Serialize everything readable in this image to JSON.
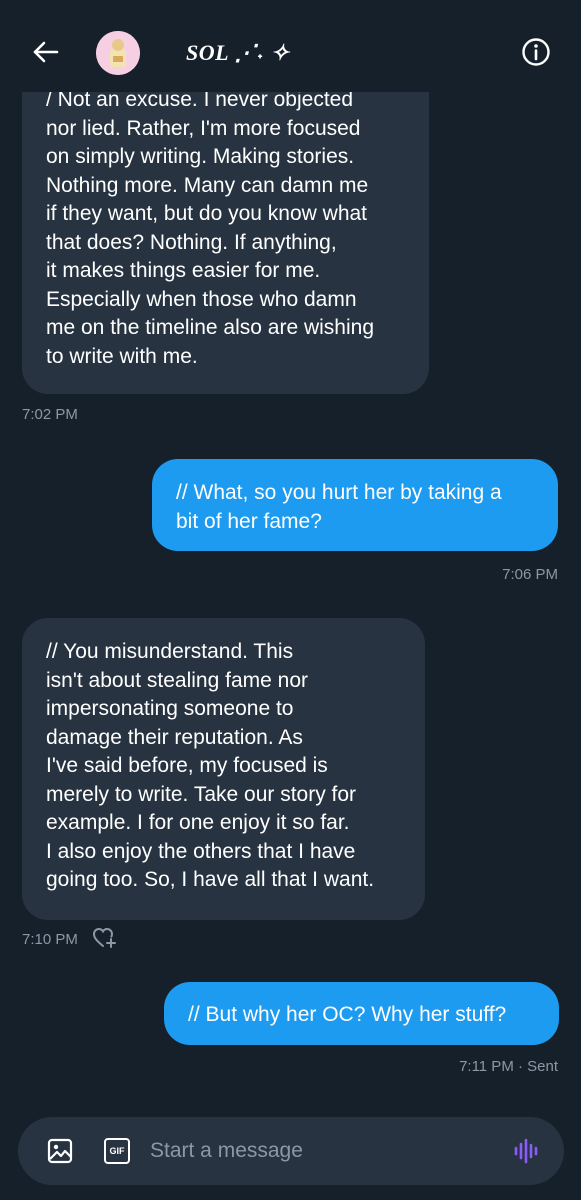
{
  "header": {
    "title": "SOL ⋰˖ ✧",
    "back_icon": "arrow-left-icon",
    "info_icon": "info-circle-icon"
  },
  "messages": [
    {
      "direction": "incoming",
      "text": "/ Not an excuse. I never objected\nnor lied. Rather, I'm more focused\non simply writing. Making stories.\nNothing more. Many can damn me\nif they want, but do you know what\nthat does? Nothing. If anything,\nit makes things easier for me.\nEspecially when those who damn\nme on the timeline also are wishing\nto write with me.",
      "time": "7:02 PM"
    },
    {
      "direction": "outgoing",
      "text": "// What, so you hurt her by taking a\nbit of her fame?",
      "time": "7:06 PM"
    },
    {
      "direction": "incoming",
      "text": "// You misunderstand. This\nisn't about stealing fame nor\nimpersonating someone to\ndamage their reputation. As\nI've said before, my focused is\nmerely to write. Take our story for\nexample. I for one enjoy it so far.\nI also enjoy the others that I have\ngoing too. So, I have all that I want.",
      "time": "7:10 PM",
      "react_icon": "heart-plus-icon"
    },
    {
      "direction": "outgoing",
      "text": "// But why her OC? Why her stuff?",
      "time": "7:11 PM · Sent"
    }
  ],
  "composer": {
    "placeholder": "Start a message",
    "media_icon": "image-icon",
    "gif_icon": "gif-icon",
    "gif_label": "GIF",
    "voice_icon": "voice-waveform-icon"
  },
  "colors": {
    "background": "#15202b",
    "incoming_bubble": "#273340",
    "outgoing_bubble": "#1d9bf0",
    "meta_text": "#8b98a5",
    "voice_accent": "#8b5cf6"
  }
}
